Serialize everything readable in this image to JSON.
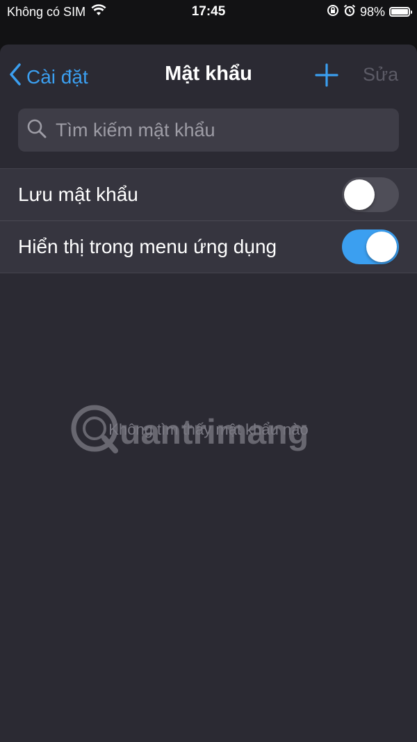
{
  "status_bar": {
    "carrier": "Không có SIM",
    "time": "17:45",
    "battery_percent": "98%",
    "battery_level": 0.98,
    "icons": [
      "wifi-icon",
      "orientation-lock-icon",
      "alarm-icon",
      "battery-icon"
    ]
  },
  "nav": {
    "back_label": "Cài đặt",
    "title": "Mật khẩu",
    "add_icon": "plus-icon",
    "edit_label": "Sửa"
  },
  "search": {
    "placeholder": "Tìm kiếm mật khẩu",
    "value": ""
  },
  "settings": [
    {
      "label": "Lưu mật khẩu",
      "enabled": false
    },
    {
      "label": "Hiển thị trong menu ứng dụng",
      "enabled": true
    }
  ],
  "empty_state": "Không tìm thấy mật khẩu nào",
  "watermark_text": "Quantrimang",
  "colors": {
    "accent": "#3b9ff0",
    "background": "#2b2a33",
    "group_background": "#36353f",
    "search_background": "#3e3d47",
    "disabled_text": "#5c5b66"
  }
}
